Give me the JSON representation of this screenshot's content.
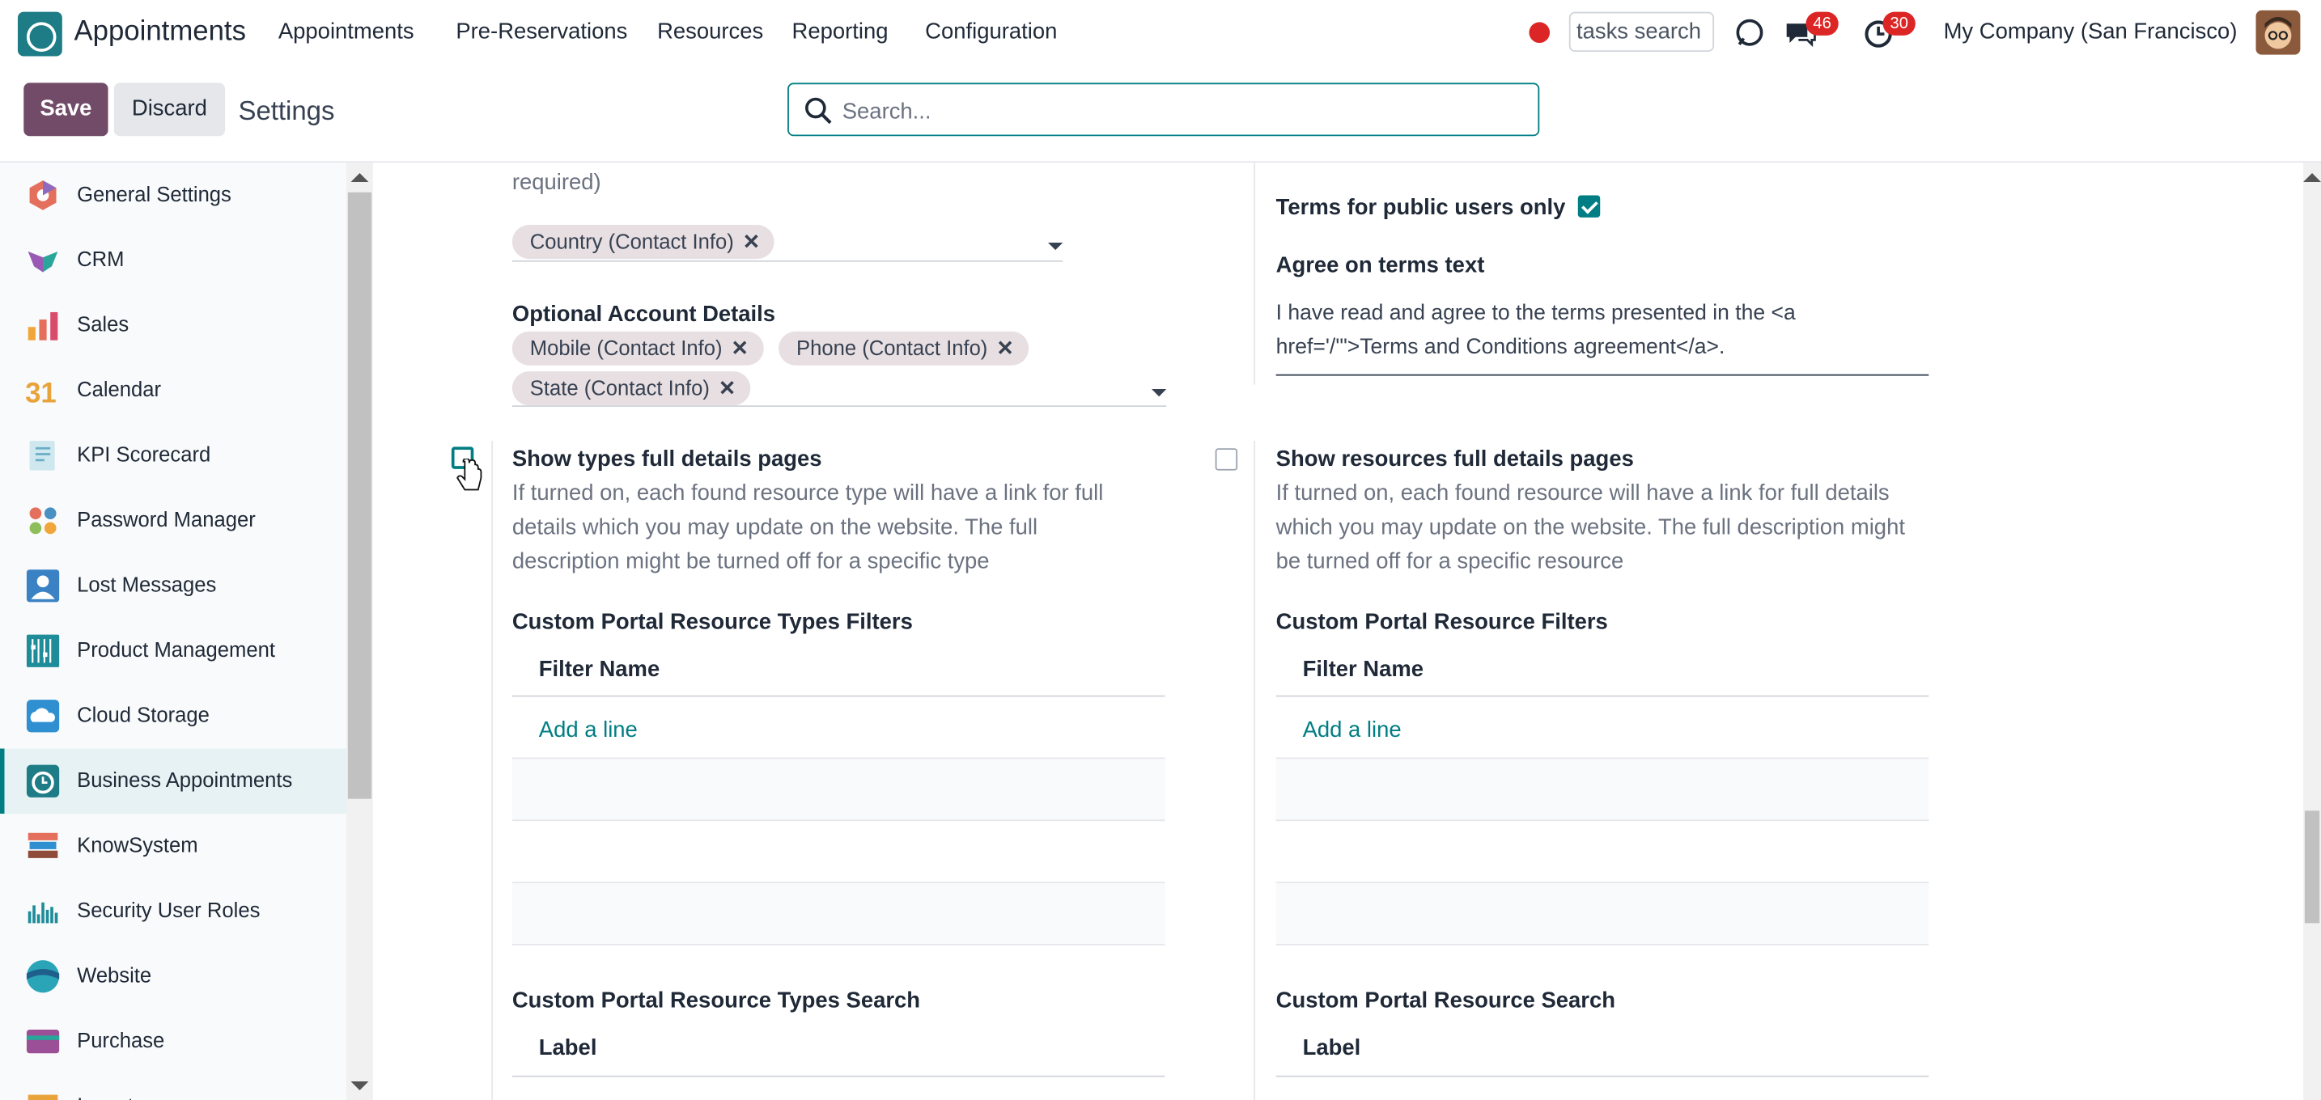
{
  "app": {
    "name": "Appointments"
  },
  "menu": [
    "Appointments",
    "Pre-Reservations",
    "Resources",
    "Reporting",
    "Configuration"
  ],
  "topbar": {
    "tasks_search": "tasks search",
    "messages_count": "46",
    "activities_count": "30",
    "company": "My Company (San Francisco)"
  },
  "control": {
    "save": "Save",
    "discard": "Discard",
    "breadcrumb": "Settings",
    "search_placeholder": "Search..."
  },
  "sidebar": {
    "items": [
      {
        "label": "General Settings",
        "icon": "general-settings-icon"
      },
      {
        "label": "CRM",
        "icon": "crm-icon"
      },
      {
        "label": "Sales",
        "icon": "sales-icon"
      },
      {
        "label": "Calendar",
        "icon": "calendar-icon"
      },
      {
        "label": "KPI Scorecard",
        "icon": "kpi-scorecard-icon"
      },
      {
        "label": "Password Manager",
        "icon": "password-manager-icon"
      },
      {
        "label": "Lost Messages",
        "icon": "lost-messages-icon"
      },
      {
        "label": "Product Management",
        "icon": "product-management-icon"
      },
      {
        "label": "Cloud Storage",
        "icon": "cloud-storage-icon"
      },
      {
        "label": "Business Appointments",
        "icon": "business-appointments-icon",
        "active": true
      },
      {
        "label": "KnowSystem",
        "icon": "knowsystem-icon"
      },
      {
        "label": "Security User Roles",
        "icon": "security-user-roles-icon"
      },
      {
        "label": "Website",
        "icon": "website-icon"
      },
      {
        "label": "Purchase",
        "icon": "purchase-icon"
      },
      {
        "label": "Inventory",
        "icon": "inventory-icon"
      }
    ]
  },
  "left": {
    "required_tail": "required)",
    "required_tags": [
      "Country (Contact Info)"
    ],
    "optional_title": "Optional Account Details",
    "optional_tags": [
      "Mobile (Contact Info)",
      "Phone (Contact Info)",
      "State (Contact Info)"
    ],
    "types_title": "Show types full details pages",
    "types_desc": [
      "If turned on, each found resource type will have a link for full",
      "details which you may update on the website. The full",
      "description might be turned off for a specific type"
    ],
    "types_checked": false,
    "filters_title": "Custom Portal Resource Types Filters",
    "filters_col": "Filter Name",
    "filters_add": "Add a line",
    "search_title": "Custom Portal Resource Types Search",
    "search_col": "Label"
  },
  "right": {
    "terms_label": "Terms for public users only",
    "terms_checked": true,
    "agree_label": "Agree on terms text",
    "agree_text": [
      "I have read and agree to the terms presented in the <a",
      "href='/'\">Terms and Conditions agreement</a>."
    ],
    "res_title": "Show resources full details pages",
    "res_desc": [
      "If turned on, each found resource will have a link for full details",
      "which you may update on the website. The full description might",
      "be turned off for a specific resource"
    ],
    "res_checked": false,
    "filters_title": "Custom Portal Resource Filters",
    "filters_col": "Filter Name",
    "filters_add": "Add a line",
    "search_title": "Custom Portal Resource Search",
    "search_col": "Label"
  },
  "colors": {
    "brand": "#714b67",
    "accent": "#017e84",
    "badge": "#dc2626"
  }
}
